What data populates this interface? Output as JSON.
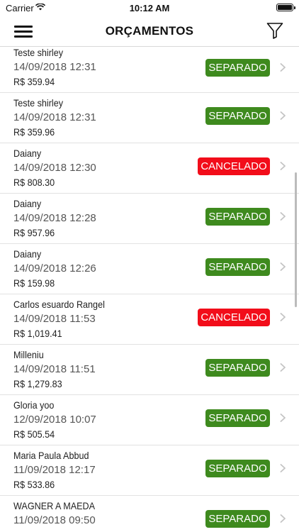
{
  "status": {
    "carrier": "Carrier",
    "time": "10:12 AM"
  },
  "nav": {
    "title": "ORÇAMENTOS"
  },
  "orders": [
    {
      "name": "Teste shirley",
      "date": "14/09/2018 12:31",
      "amount": "R$ 359.94",
      "status": "SEPARADO",
      "status_type": "separado"
    },
    {
      "name": "Teste shirley",
      "date": "14/09/2018 12:31",
      "amount": "R$ 359.96",
      "status": "SEPARADO",
      "status_type": "separado"
    },
    {
      "name": "Daiany",
      "date": "14/09/2018 12:30",
      "amount": "R$ 808.30",
      "status": "CANCELADO",
      "status_type": "cancelado"
    },
    {
      "name": "Daiany",
      "date": "14/09/2018 12:28",
      "amount": "R$ 957.96",
      "status": "SEPARADO",
      "status_type": "separado"
    },
    {
      "name": "Daiany",
      "date": "14/09/2018 12:26",
      "amount": "R$ 159.98",
      "status": "SEPARADO",
      "status_type": "separado"
    },
    {
      "name": "Carlos esuardo Rangel",
      "date": "14/09/2018 11:53",
      "amount": "R$ 1,019.41",
      "status": "CANCELADO",
      "status_type": "cancelado"
    },
    {
      "name": "Milleniu",
      "date": "14/09/2018 11:51",
      "amount": "R$ 1,279.83",
      "status": "SEPARADO",
      "status_type": "separado"
    },
    {
      "name": "Gloria yoo",
      "date": "12/09/2018 10:07",
      "amount": "R$ 505.54",
      "status": "SEPARADO",
      "status_type": "separado"
    },
    {
      "name": "Maria Paula Abbud",
      "date": "11/09/2018 12:17",
      "amount": "R$ 533.86",
      "status": "SEPARADO",
      "status_type": "separado"
    },
    {
      "name": "WAGNER A MAEDA",
      "date": "11/09/2018 09:50",
      "amount": "",
      "status": "SEPARADO",
      "status_type": "separado"
    }
  ],
  "colors": {
    "separado": "#3e8a1e",
    "cancelado": "#f20d1a"
  },
  "icons": {
    "menu": "hamburger-menu-icon",
    "filter": "filter-funnel-icon",
    "chevron": "chevron-right-icon"
  }
}
